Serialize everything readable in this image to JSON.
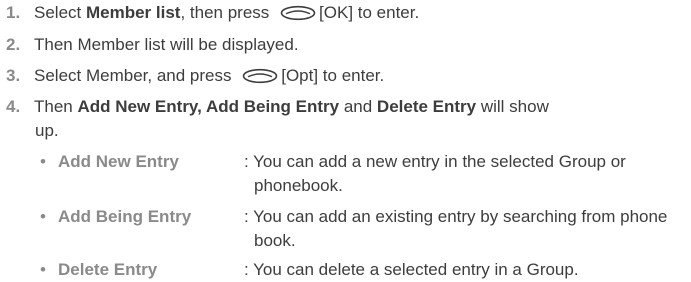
{
  "steps": [
    {
      "number": "1.",
      "pre": "Select ",
      "bold": "Member list",
      "mid": ", then press ",
      "key": "[OK] to enter."
    },
    {
      "number": "2.",
      "text": "Then Member list will be displayed."
    },
    {
      "number": "3.",
      "pre": "Select Member, and press ",
      "key": "[Opt] to enter."
    },
    {
      "number": "4.",
      "pre": "Then ",
      "bold1": "Add New Entry, Add Being Entry",
      "mid1": " and ",
      "bold2": "Delete Entry",
      "post": " will show",
      "cont": "up."
    }
  ],
  "options": [
    {
      "bullet": "•",
      "label": "Add New Entry",
      "desc": ": You can add a new entry in the selected Group or phonebook."
    },
    {
      "bullet": "•",
      "label": "Add Being Entry",
      "desc": ": You can add an existing entry by searching from phone book."
    },
    {
      "bullet": "•",
      "label": "Delete Entry",
      "desc": ": You can delete a selected entry in a Group."
    }
  ],
  "icons": {
    "ok_key": "ok-key-icon",
    "opt_key": "opt-key-icon"
  }
}
